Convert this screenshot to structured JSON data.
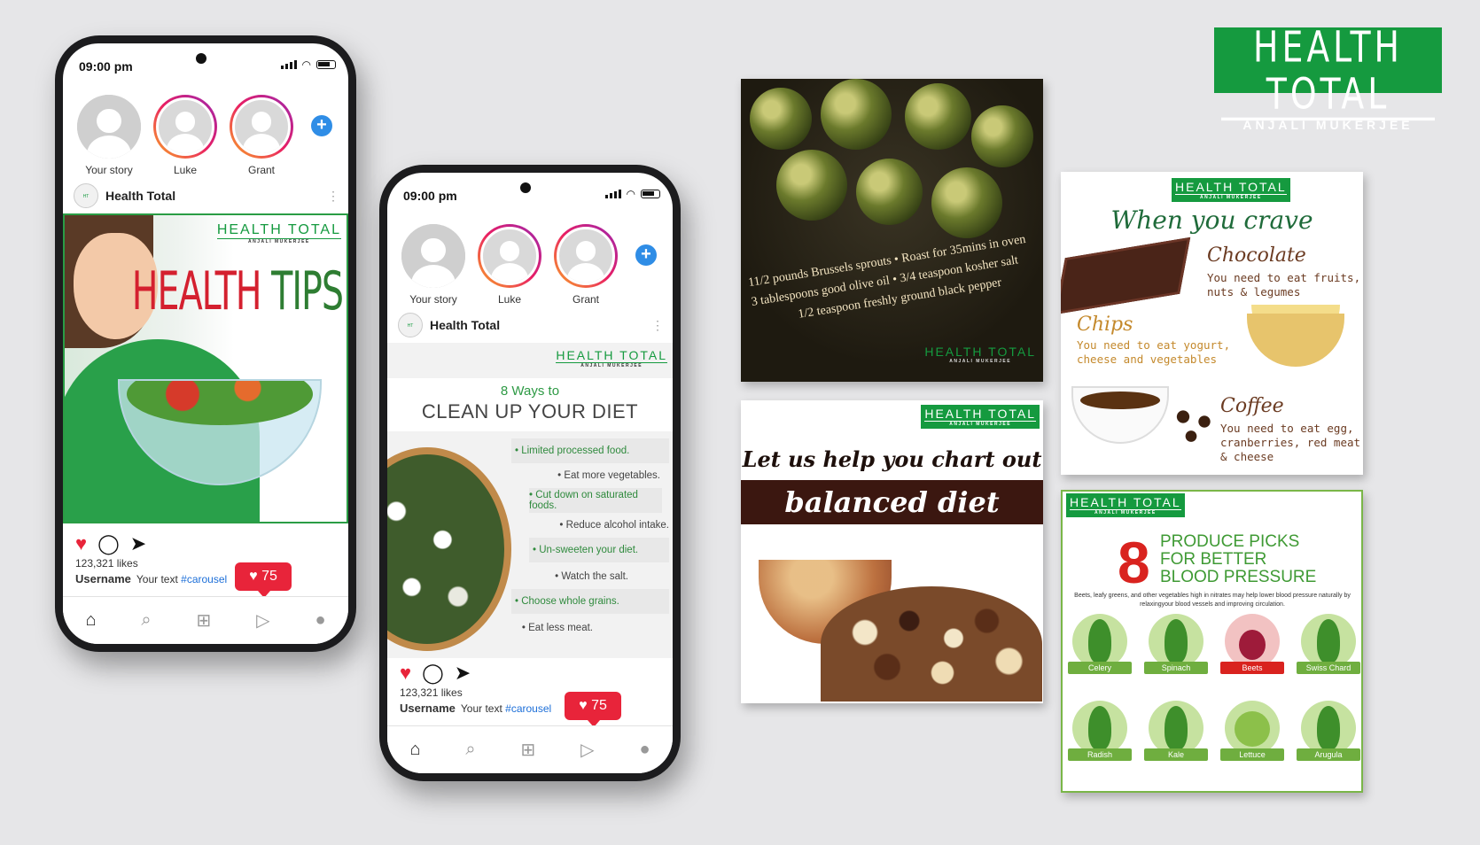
{
  "brand": {
    "name": "HEALTH TOTAL",
    "tagline": "ANJALI MUKERJEE",
    "color": "#159a3f"
  },
  "phone1": {
    "time": "09:00 pm",
    "stories": [
      {
        "label": "Your story"
      },
      {
        "label": "Luke"
      },
      {
        "label": "Grant"
      }
    ],
    "add_story_icon": "+",
    "account_name": "Health Total",
    "post": {
      "logo_main": "HEALTH TOTAL",
      "logo_sub": "ANJALI MUKERJEE",
      "title_red": "HEALTH",
      "title_green": " TIPS"
    },
    "likes": "123,321 likes",
    "username": "Username",
    "caption_text": "Your text ",
    "caption_tag": "#carousel",
    "like_count": "♥ 75"
  },
  "phone2": {
    "time": "09:00 pm",
    "stories": [
      {
        "label": "Your story"
      },
      {
        "label": "Luke"
      },
      {
        "label": "Grant"
      }
    ],
    "add_story_icon": "+",
    "account_name": "Health Total",
    "post": {
      "logo_main": "HEALTH TOTAL",
      "logo_sub": "ANJALI MUKERJEE",
      "subtitle": "8 Ways to",
      "title": "CLEAN UP YOUR DIET",
      "tips": [
        "• Limited processed food.",
        "• Eat more vegetables.",
        "• Cut down on saturated foods.",
        "• Reduce alcohol intake.",
        "• Un-sweeten your diet.",
        "• Watch the salt.",
        "• Choose whole grains.",
        "• Eat less meat."
      ]
    },
    "likes": "123,321 likes",
    "username": "Username",
    "caption_text": "Your text ",
    "caption_tag": "#carousel",
    "like_count": "♥ 75"
  },
  "card_sprouts": {
    "lines": [
      "11/2 pounds Brussels sprouts  •  Roast for 35mins in oven",
      "3 tablespoons good olive oil  •  3/4 teaspoon kosher salt",
      "1/2 teaspoon freshly ground black pepper"
    ],
    "logo_main": "HEALTH TOTAL",
    "logo_sub": "ANJALI MUKERJEE"
  },
  "card_diet": {
    "logo_main": "HEALTH TOTAL",
    "logo_sub": "ANJALI MUKERJEE",
    "line1": "Let us help you chart out a",
    "line2": "balanced diet"
  },
  "card_crave": {
    "logo_main": "HEALTH TOTAL",
    "logo_sub": "ANJALI MUKERJEE",
    "title": "When you crave",
    "items": [
      {
        "heading": "Chocolate",
        "text": "You need to eat fruits, nuts & legumes"
      },
      {
        "heading": "Chips",
        "text": "You need to eat yogurt, cheese and vegetables"
      },
      {
        "heading": "Coffee",
        "text": "You need to eat egg, cranberries, red meat & cheese"
      }
    ]
  },
  "card_produce": {
    "logo_main": "HEALTH TOTAL",
    "logo_sub": "ANJALI MUKERJEE",
    "number": "8",
    "heading_line1": "PRODUCE PICKS",
    "heading_line2": "FOR BETTER",
    "heading_line3": "BLOOD PRESSURE",
    "note": "Beets, leafy greens, and other vegetables high in nitrates may help lower blood pressure naturally by relaxingyour blood vessels and improving circulation.",
    "vegetables": [
      "Celery",
      "Spinach",
      "Beets",
      "Swiss Chard",
      "Radish",
      "Kale",
      "Lettuce",
      "Arugula"
    ]
  }
}
